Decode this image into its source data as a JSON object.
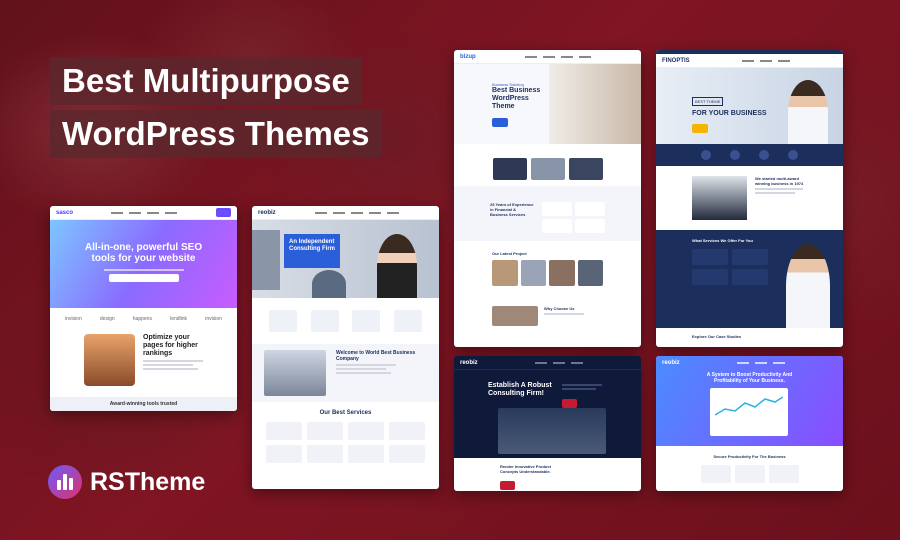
{
  "headline": {
    "line1": "Best Multipurpose",
    "line2": "WordPress Themes"
  },
  "logo": {
    "name": "RSTheme"
  },
  "colors": {
    "accent_red": "#c41a32",
    "navy": "#1b2e5c",
    "blue": "#2b5fd9",
    "purple": "#7a4dff"
  },
  "themes": [
    {
      "brand": "sasco",
      "hero": "All-in-one, powerful SEO tools for your website",
      "section": "Optimize your pages for higher rankings",
      "footer": "Award-winning tools trusted",
      "partners": [
        "invision",
        "design",
        "happens",
        "lendlink",
        "invision"
      ]
    },
    {
      "brand": "reobiz",
      "hero": "An Independent Consulting Firm",
      "section": "Welcome to World Best Business Company",
      "services": "Our Best Services"
    },
    {
      "brand": "bizup",
      "hero_kicker": "Business Solution",
      "hero": "Best Business WordPress Theme",
      "section": "25 Years of Experience in Financial & Business Services",
      "projects": "Our Latest Project",
      "why": "Why Choose Us"
    },
    {
      "brand": "FINOPTIS",
      "badge": "BEST THEME",
      "hero": "FOR YOUR BUSINESS",
      "section": "We started multi-award winning business in 1974",
      "services": "What Services We Offer For You",
      "cases": "Explore Our Case Studies"
    },
    {
      "brand": "reobiz",
      "hero": "Establish A Robust Consulting Firm!",
      "section": "Render Innovative Product Concepts Understandable."
    },
    {
      "brand": "reobiz",
      "hero": "A System to Boost Productivity And Profitability of Your Business.",
      "section": "Secure Productivity For The Business"
    }
  ]
}
